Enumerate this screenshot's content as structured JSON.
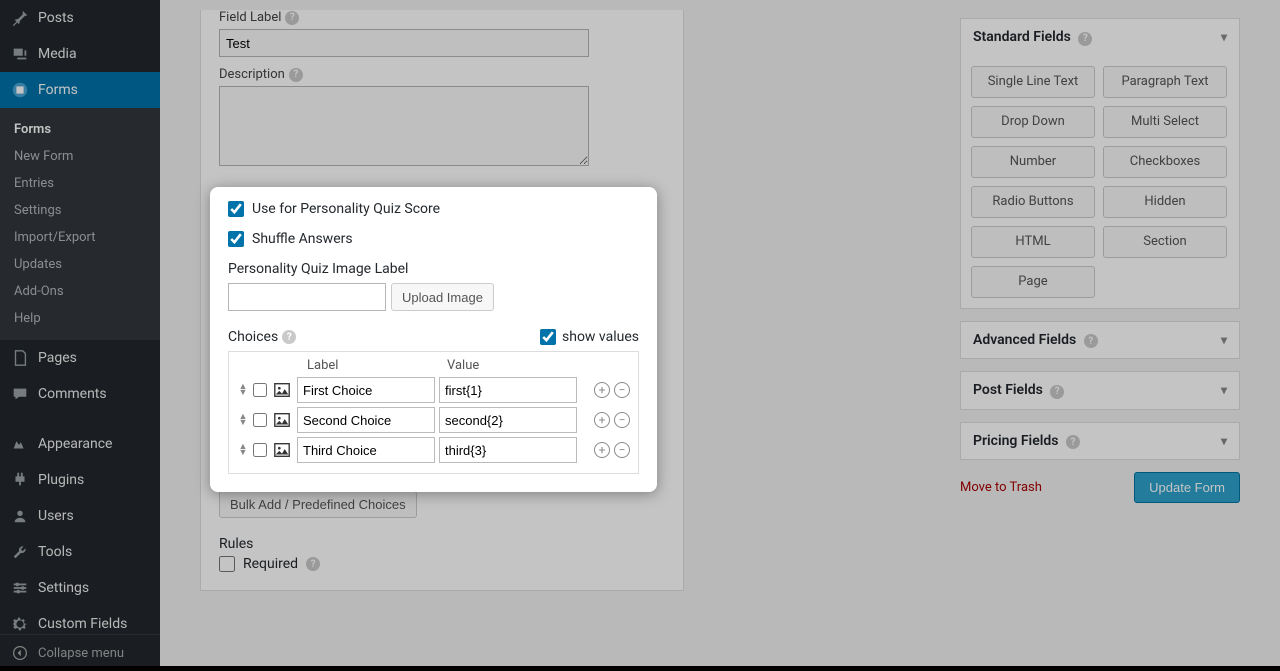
{
  "sidebar": {
    "items": [
      {
        "label": "Posts"
      },
      {
        "label": "Media"
      },
      {
        "label": "Forms"
      },
      {
        "label": "Pages"
      },
      {
        "label": "Comments"
      },
      {
        "label": "Appearance"
      },
      {
        "label": "Plugins"
      },
      {
        "label": "Users"
      },
      {
        "label": "Tools"
      },
      {
        "label": "Settings"
      },
      {
        "label": "Custom Fields"
      }
    ],
    "forms_submenu": [
      "Forms",
      "New Form",
      "Entries",
      "Settings",
      "Import/Export",
      "Updates",
      "Add-Ons",
      "Help"
    ],
    "collapse": "Collapse menu"
  },
  "field": {
    "label_label": "Field Label",
    "label_value": "Test",
    "description_label": "Description",
    "description_value": "",
    "use_quiz": "Use for Personality Quiz Score",
    "shuffle": "Shuffle Answers",
    "quiz_img_label": "Personality Quiz Image Label",
    "quiz_img_value": "",
    "upload_btn": "Upload Image",
    "choices_label": "Choices",
    "show_values": "show values",
    "col_label": "Label",
    "col_value": "Value",
    "choices": [
      {
        "label": "First Choice",
        "value": "first{1}"
      },
      {
        "label": "Second Choice",
        "value": "second{2}"
      },
      {
        "label": "Third Choice",
        "value": "third{3}"
      }
    ],
    "bulk_btn": "Bulk Add / Predefined Choices",
    "rules_label": "Rules",
    "required_label": "Required"
  },
  "right": {
    "standard": {
      "title": "Standard Fields",
      "buttons": [
        "Single Line Text",
        "Paragraph Text",
        "Drop Down",
        "Multi Select",
        "Number",
        "Checkboxes",
        "Radio Buttons",
        "Hidden",
        "HTML",
        "Section",
        "Page"
      ]
    },
    "advanced": "Advanced Fields",
    "post": "Post Fields",
    "pricing": "Pricing Fields",
    "trash": "Move to Trash",
    "update": "Update Form"
  }
}
